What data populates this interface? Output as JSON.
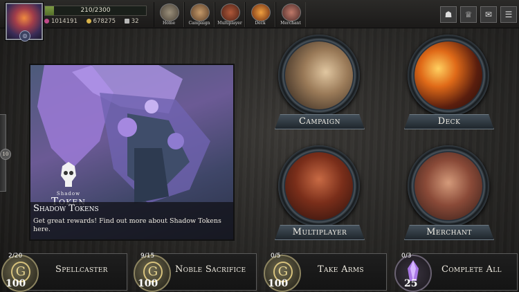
{
  "player": {
    "level_badge": "◎",
    "xp_text": "210/2300",
    "xp_fraction": 0.0913,
    "currency": [
      {
        "icon": "gem-icon",
        "value": "1014191",
        "color": "#c04a8a"
      },
      {
        "icon": "gold-coin-icon",
        "value": "678275",
        "color": "#d9b44a"
      },
      {
        "icon": "shadow-token-icon",
        "value": "32",
        "color": "#b8b8b8"
      }
    ]
  },
  "nav": [
    {
      "label": "Home"
    },
    {
      "label": "Campaign"
    },
    {
      "label": "Multiplayer"
    },
    {
      "label": "Deck"
    },
    {
      "label": "Merchant"
    }
  ],
  "topright": [
    {
      "icon": "guild-icon",
      "glyph": "☗"
    },
    {
      "icon": "trophy-icon",
      "glyph": "♕"
    },
    {
      "icon": "mail-icon",
      "glyph": "✉"
    },
    {
      "icon": "menu-icon",
      "glyph": "☰"
    }
  ],
  "side_tab": {
    "badge": "10"
  },
  "banner": {
    "logo_small": "Shadow",
    "logo_big": "Token",
    "title": "Shadow Tokens",
    "description": "Get great rewards! Find out more about Shadow Tokens here."
  },
  "menu": [
    {
      "label": "Campaign"
    },
    {
      "label": "Deck"
    },
    {
      "label": "Multiplayer"
    },
    {
      "label": "Merchant"
    }
  ],
  "quests": [
    {
      "progress": "2/20",
      "label": "Spellcaster",
      "reward": "100",
      "reward_type": "gold"
    },
    {
      "progress": "9/15",
      "label": "Noble Sacrifice",
      "reward": "100",
      "reward_type": "gold"
    },
    {
      "progress": "0/5",
      "label": "Take Arms",
      "reward": "100",
      "reward_type": "gold"
    },
    {
      "progress": "0/3",
      "label": "Complete All",
      "reward": "25",
      "reward_type": "gem"
    }
  ]
}
